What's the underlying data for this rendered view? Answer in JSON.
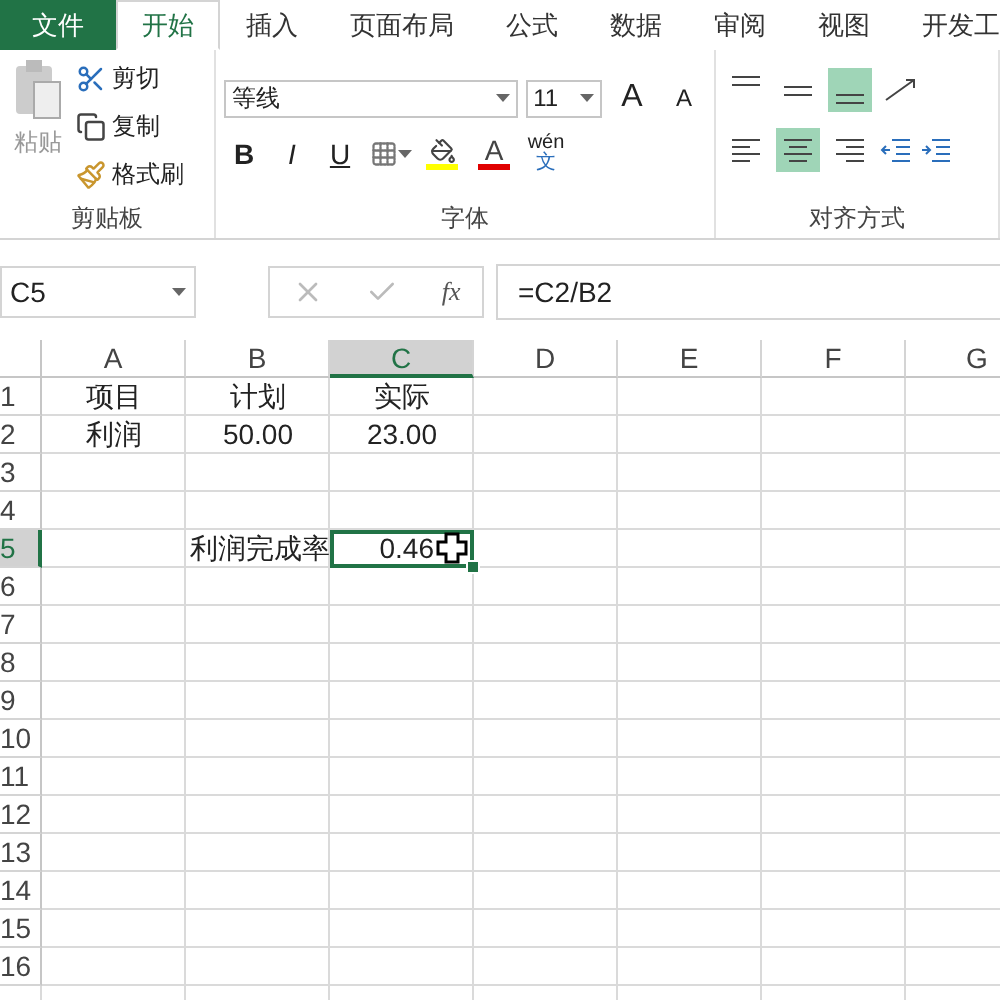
{
  "tabs": [
    {
      "label": "文件",
      "kind": "file",
      "selected": false
    },
    {
      "label": "开始",
      "kind": "normal",
      "selected": true
    },
    {
      "label": "插入",
      "kind": "normal",
      "selected": false
    },
    {
      "label": "页面布局",
      "kind": "normal",
      "selected": false
    },
    {
      "label": "公式",
      "kind": "normal",
      "selected": false
    },
    {
      "label": "数据",
      "kind": "normal",
      "selected": false
    },
    {
      "label": "审阅",
      "kind": "normal",
      "selected": false
    },
    {
      "label": "视图",
      "kind": "normal",
      "selected": false
    },
    {
      "label": "开发工",
      "kind": "normal",
      "selected": false
    }
  ],
  "clipboard": {
    "paste": "粘贴",
    "label": "剪贴板",
    "items": [
      {
        "label": "剪切",
        "kind": "cut"
      },
      {
        "label": "复制",
        "kind": "copy"
      },
      {
        "label": "格式刷",
        "kind": "painter"
      }
    ]
  },
  "font": {
    "label": "字体",
    "font_name": "等线",
    "font_size": "11",
    "grow": "A",
    "shrink": "A",
    "buttons": [
      {
        "kind": "bold",
        "text": "B"
      },
      {
        "kind": "italic",
        "text": "I"
      },
      {
        "kind": "underline",
        "text": "U"
      },
      {
        "kind": "border"
      },
      {
        "kind": "fill"
      },
      {
        "kind": "font_color",
        "text": "A"
      },
      {
        "kind": "phonetic",
        "text": "wén",
        "subtext": "文"
      }
    ]
  },
  "alignment": {
    "label": "对齐方式",
    "vertical": [
      {
        "kind": "top",
        "selected": false
      },
      {
        "kind": "middle",
        "selected": false
      },
      {
        "kind": "bottom",
        "selected": true
      }
    ],
    "horizontal": [
      {
        "kind": "left",
        "selected": false
      },
      {
        "kind": "center",
        "selected": true
      },
      {
        "kind": "right",
        "selected": false
      }
    ]
  },
  "formula_bar": {
    "name_box": "C5",
    "fx": "fx",
    "formula": "=C2/B2"
  },
  "sheet": {
    "columns": [
      {
        "label": "A",
        "selected": false
      },
      {
        "label": "B",
        "selected": false
      },
      {
        "label": "C",
        "selected": true
      },
      {
        "label": "D",
        "selected": false
      },
      {
        "label": "E",
        "selected": false
      },
      {
        "label": "F",
        "selected": false
      },
      {
        "label": "G",
        "selected": false
      }
    ],
    "rows": [
      {
        "label": "1",
        "selected": false,
        "right_aligned": false,
        "cells": [
          "项目",
          "计划",
          "实际"
        ]
      },
      {
        "label": "2",
        "selected": false,
        "right_aligned": false,
        "cells": [
          "利润",
          "50.00",
          "23.00"
        ]
      },
      {
        "label": "3",
        "selected": false
      },
      {
        "label": "4",
        "selected": false
      },
      {
        "label": "5",
        "selected": true,
        "right_aligned": true,
        "cells": [
          null,
          "利润完成率",
          "0.46"
        ]
      },
      {
        "label": "6",
        "selected": false
      },
      {
        "label": "7",
        "selected": false
      },
      {
        "label": "8",
        "selected": false
      },
      {
        "label": "9",
        "selected": false
      },
      {
        "label": "10",
        "selected": false
      },
      {
        "label": "11",
        "selected": false
      },
      {
        "label": "12",
        "selected": false
      },
      {
        "label": "13",
        "selected": false
      },
      {
        "label": "14",
        "selected": false
      },
      {
        "label": "15",
        "selected": false
      },
      {
        "label": "16",
        "selected": false
      }
    ]
  }
}
